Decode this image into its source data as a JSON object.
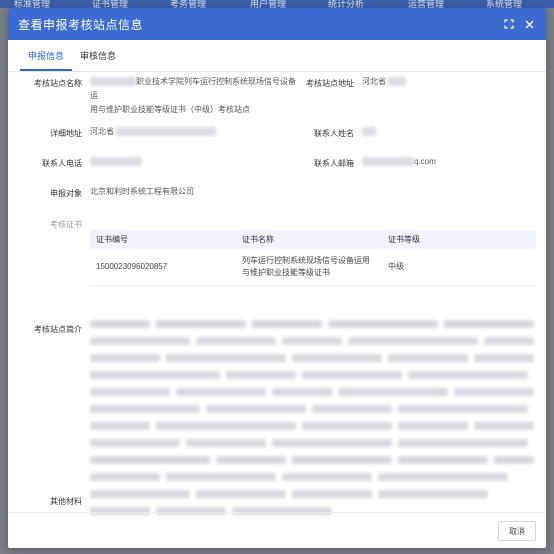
{
  "background": {
    "nav_items": [
      "标准管理",
      "证书管理",
      "考务管理",
      "用户管理",
      "统计分析",
      "运营管理",
      "系统管理"
    ]
  },
  "modal": {
    "title": "查看申报考核站点信息",
    "tabs": [
      {
        "label": "申报信息",
        "active": true
      },
      {
        "label": "审核信息",
        "active": false
      }
    ],
    "fields": {
      "site_name_label": "考核站点名称",
      "site_name_value_line1": "职业技术学院列车运行控制系统现场信号设备运",
      "site_name_value_line2": "用与维护职业技能等级证书（中级）考核站点",
      "site_address_label": "考核站点地址",
      "site_address_value": "河北省",
      "detail_address_label": "详细地址",
      "detail_address_value": "河北省",
      "contact_name_label": "联系人姓名",
      "contact_phone_label": "联系人电话",
      "contact_email_label": "联系人邮箱",
      "contact_email_value": "q.com",
      "applicant_label": "申报对象",
      "applicant_value": "北京和利时系统工程有限公司",
      "certificate_label": "考核证书",
      "intro_label": "考核站点简介",
      "other_materials_label": "其他材料"
    },
    "certificate_table": {
      "headers": [
        "证书编号",
        "证书名称",
        "证书等级"
      ],
      "rows": [
        [
          "1500023096020857",
          "列车运行控制系统现场信号设备运用与维护职业技能等级证书",
          "中级"
        ]
      ]
    },
    "cancel_label": "取消"
  }
}
